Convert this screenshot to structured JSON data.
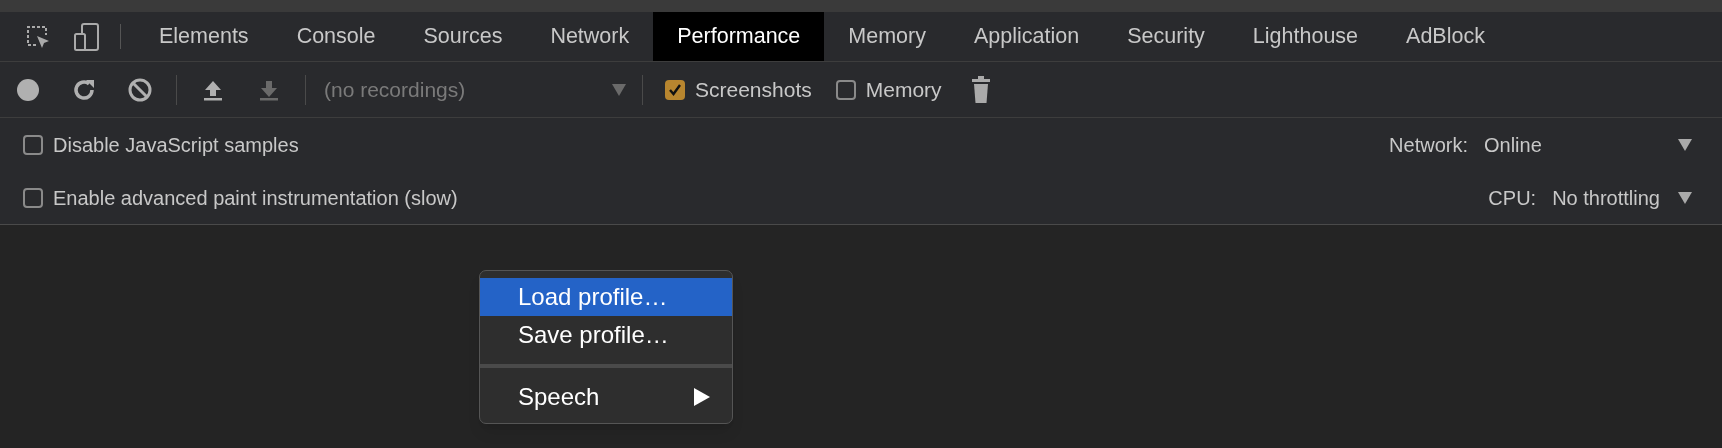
{
  "tabs": [
    {
      "label": "Elements",
      "selected": false
    },
    {
      "label": "Console",
      "selected": false
    },
    {
      "label": "Sources",
      "selected": false
    },
    {
      "label": "Network",
      "selected": false
    },
    {
      "label": "Performance",
      "selected": true
    },
    {
      "label": "Memory",
      "selected": false
    },
    {
      "label": "Application",
      "selected": false
    },
    {
      "label": "Security",
      "selected": false
    },
    {
      "label": "Lighthouse",
      "selected": false
    },
    {
      "label": "AdBlock",
      "selected": false
    }
  ],
  "toolbar": {
    "buttons": [
      {
        "kind": "record",
        "disabled": false
      },
      {
        "kind": "reload",
        "disabled": false
      },
      {
        "kind": "clear",
        "disabled": false
      },
      {
        "kind": "upload",
        "disabled": false
      },
      {
        "kind": "download",
        "disabled": true
      }
    ],
    "recordings": {
      "value": "(no recordings)"
    },
    "options": [
      {
        "label": "Screenshots",
        "checked": true
      },
      {
        "label": "Memory",
        "checked": false
      }
    ]
  },
  "settings": [
    {
      "label": "Disable JavaScript samples",
      "checked": false,
      "setting_label": "Network:",
      "setting_value": "Online"
    },
    {
      "label": "Enable advanced paint instrumentation (slow)",
      "checked": false,
      "setting_label": "CPU:",
      "setting_value": "No throttling"
    }
  ],
  "context_menu": [
    {
      "kind": "item",
      "label": "Load profile…",
      "selected": true
    },
    {
      "kind": "item",
      "label": "Save profile…",
      "selected": false
    },
    {
      "kind": "separator"
    },
    {
      "kind": "submenu",
      "label": "Speech",
      "selected": false
    }
  ]
}
